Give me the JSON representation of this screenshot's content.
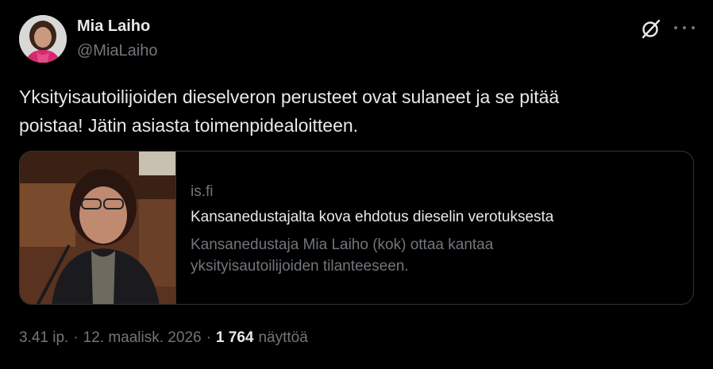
{
  "author": {
    "name": "Mia Laiho",
    "handle": "@MiaLaiho"
  },
  "icons": {
    "grok": "grok-slash-icon",
    "more": "more-dots-icon"
  },
  "tweet": {
    "text": "Yksityisautoilijoiden dieselveron perusteet ovat sulaneet ja se pitää\npoistaa! Jätin asiasta toimenpidealoitteen."
  },
  "card": {
    "domain": "is.fi",
    "title": "Kansanedustajalta kova ehdotus dieselin verotuksesta",
    "description": "Kansanedustaja Mia Laiho (kok) ottaa kantaa\nyksityisautoilijoiden tilanteeseen."
  },
  "meta": {
    "time": "3.41 ip.",
    "separator": "·",
    "date": "12. maalisk. 2026",
    "views_count": "1 764",
    "views_label": "näyttöä"
  },
  "colors": {
    "background": "#000000",
    "text_primary": "#e7e9ea",
    "text_secondary": "#71767b",
    "border": "#2f3336"
  }
}
